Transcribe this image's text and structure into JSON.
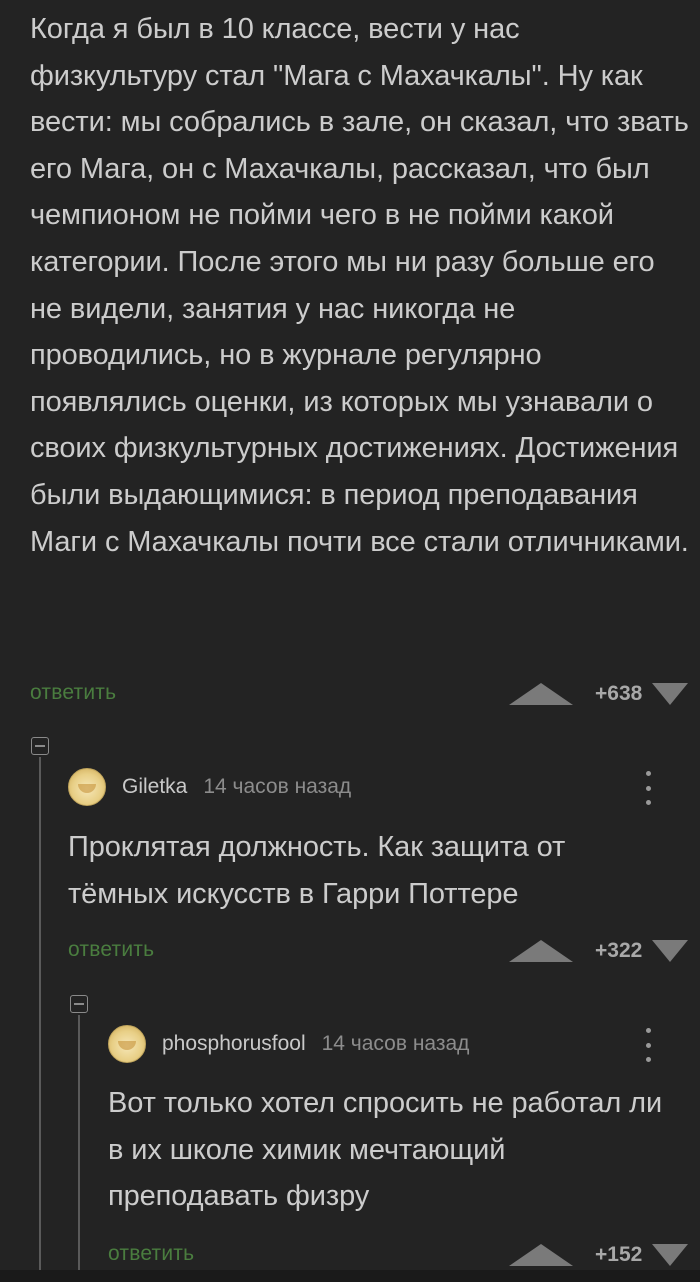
{
  "comments": [
    {
      "text": "Когда я был в 10 классе, вести у нас физкультуру стал \"Мага с Махачкалы\". Ну как вести: мы собрались в зале, он сказал, что звать его Мага, он с Махачкалы, рассказал, что был чемпионом не пойми чего в не пойми какой категории. После этого мы ни разу больше его не видели, занятия у нас никогда не проводились, но в журнале регулярно появлялись оценки, из которых мы узнавали о своих физкультурных достижениях. Достижения были выдающимися: в период преподавания Маги с Махачкалы почти все стали отличниками.",
      "reply_label": "ответить",
      "score": "+638"
    },
    {
      "username": "Giletka",
      "timestamp": "14 часов назад",
      "text": "Проклятая должность. Как защита от тёмных искусств в Гарри Поттере",
      "reply_label": "ответить",
      "score": "+322"
    },
    {
      "username": "phosphorusfool",
      "timestamp": "14 часов назад",
      "text": "Вот только хотел спросить не работал ли в их школе химик мечтающий преподавать физру",
      "reply_label": "ответить",
      "score": "+152"
    }
  ],
  "colors": {
    "background": "#232323",
    "text": "#cccccc",
    "reply_link": "#4a7d3f",
    "vote_arrow": "#7a7a7a",
    "thread_line": "#5a5a5a"
  },
  "icons": {
    "upvote": "triangle-up-icon",
    "downvote": "triangle-down-icon",
    "collapse": "minus-square-icon",
    "more": "vertical-dots-icon",
    "avatar": "user-avatar"
  }
}
